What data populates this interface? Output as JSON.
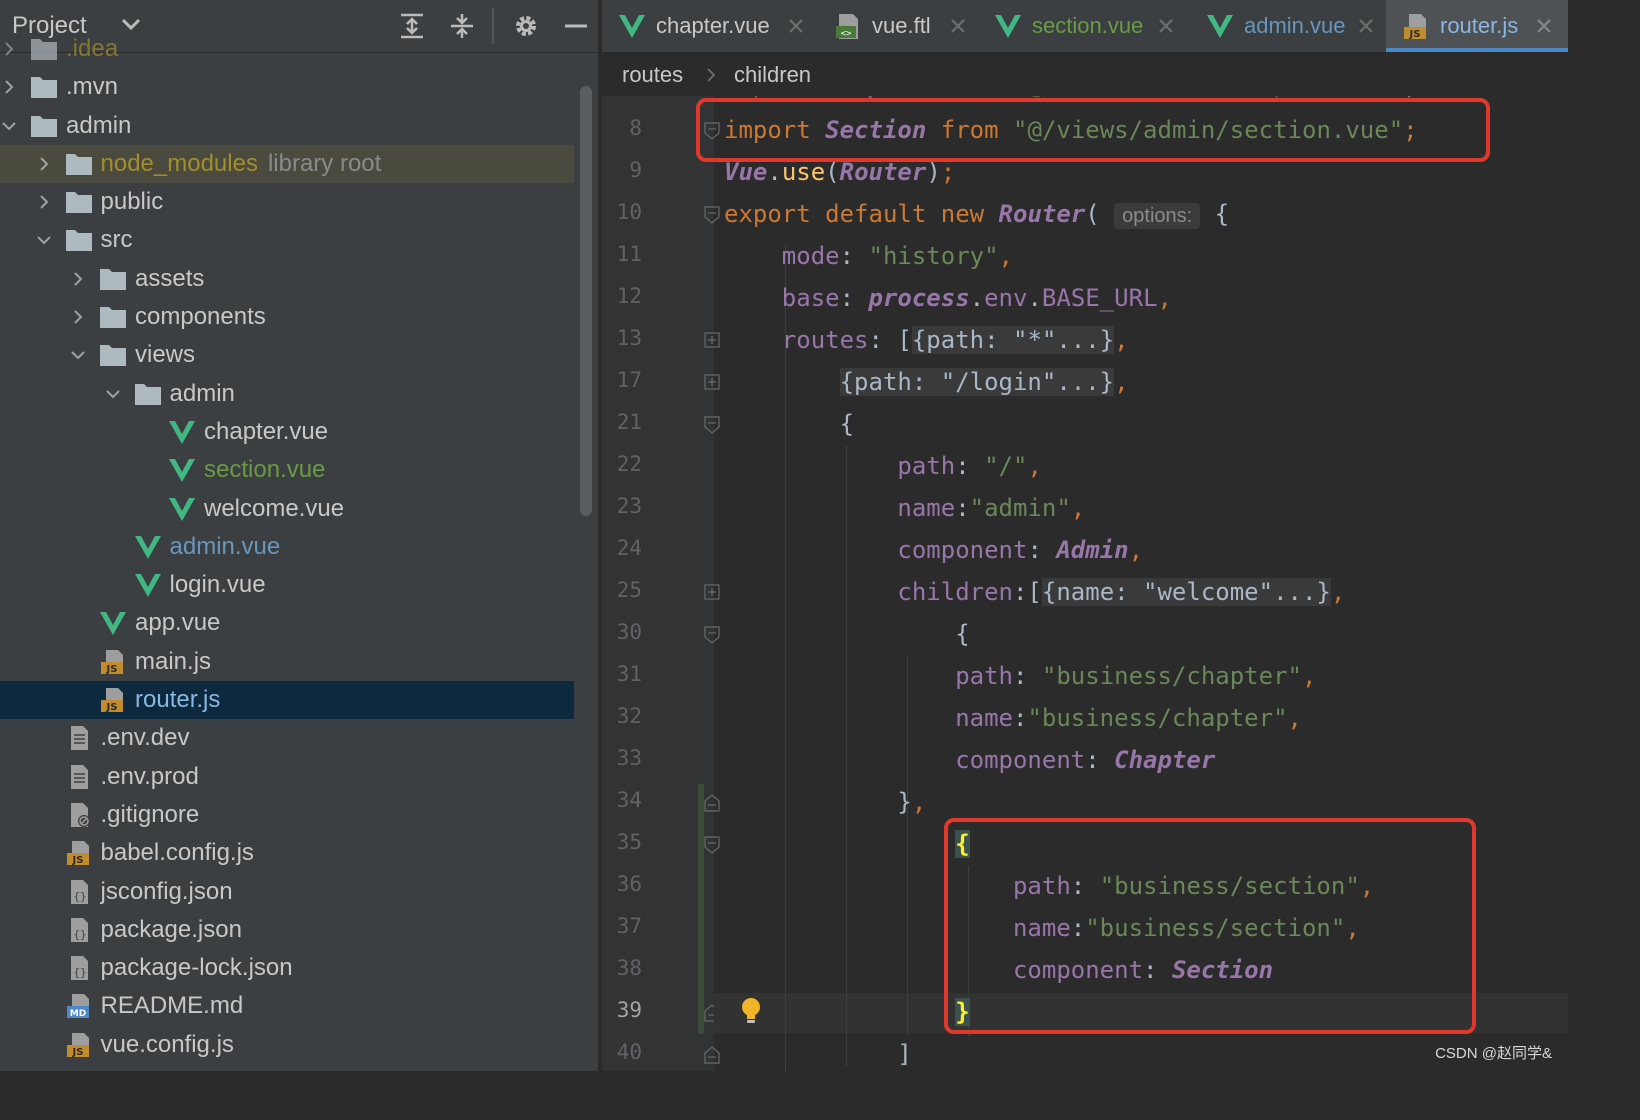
{
  "project_panel": {
    "title": "Project",
    "tree": [
      {
        "label": ".idea",
        "type": "folder",
        "depth": 0,
        "state": "collapsed",
        "style": "yellow"
      },
      {
        "label": ".mvn",
        "type": "folder",
        "depth": 0,
        "state": "collapsed"
      },
      {
        "label": "admin",
        "type": "folder",
        "depth": 0,
        "state": "expanded"
      },
      {
        "label": "node_modules",
        "suffix": "library root",
        "type": "folder",
        "depth": 1,
        "state": "collapsed",
        "style": "yellow",
        "highlight": true
      },
      {
        "label": "public",
        "type": "folder",
        "depth": 1,
        "state": "collapsed"
      },
      {
        "label": "src",
        "type": "folder",
        "depth": 1,
        "state": "expanded"
      },
      {
        "label": "assets",
        "type": "folder",
        "depth": 2,
        "state": "collapsed"
      },
      {
        "label": "components",
        "type": "folder",
        "depth": 2,
        "state": "collapsed"
      },
      {
        "label": "views",
        "type": "folder",
        "depth": 2,
        "state": "expanded"
      },
      {
        "label": "admin",
        "type": "folder",
        "depth": 3,
        "state": "expanded"
      },
      {
        "label": "chapter.vue",
        "type": "vue",
        "depth": 4
      },
      {
        "label": "section.vue",
        "type": "vue",
        "depth": 4,
        "style": "green"
      },
      {
        "label": "welcome.vue",
        "type": "vue",
        "depth": 4
      },
      {
        "label": "admin.vue",
        "type": "vue",
        "depth": 3,
        "style": "blue"
      },
      {
        "label": "login.vue",
        "type": "vue",
        "depth": 3
      },
      {
        "label": "app.vue",
        "type": "vue",
        "depth": 2
      },
      {
        "label": "main.js",
        "type": "js",
        "depth": 2
      },
      {
        "label": "router.js",
        "type": "js",
        "depth": 2,
        "selected": true
      },
      {
        "label": ".env.dev",
        "type": "text",
        "depth": 1
      },
      {
        "label": ".env.prod",
        "type": "text",
        "depth": 1
      },
      {
        "label": ".gitignore",
        "type": "ignore",
        "depth": 1
      },
      {
        "label": "babel.config.js",
        "type": "js",
        "depth": 1
      },
      {
        "label": "jsconfig.json",
        "type": "json",
        "depth": 1
      },
      {
        "label": "package.json",
        "type": "json",
        "depth": 1
      },
      {
        "label": "package-lock.json",
        "type": "json",
        "depth": 1
      },
      {
        "label": "README.md",
        "type": "md",
        "depth": 1
      },
      {
        "label": "vue.config.js",
        "type": "js",
        "depth": 1
      }
    ]
  },
  "tabs": [
    {
      "label": "chapter.vue",
      "icon": "vue-icon"
    },
    {
      "label": "vue.ftl",
      "icon": "ftl-icon"
    },
    {
      "label": "section.vue",
      "icon": "vue-icon",
      "style": "green"
    },
    {
      "label": "admin.vue",
      "icon": "vue-icon",
      "style": "blue"
    },
    {
      "label": "router.js",
      "icon": "js-icon",
      "active": true,
      "style": "blue"
    }
  ],
  "breadcrumb": [
    "routes",
    "children"
  ],
  "editor": {
    "current_line": 39,
    "hint_label": "options:",
    "lines": [
      {
        "n": 8,
        "fold": "start"
      },
      {
        "n": 9
      },
      {
        "n": 10,
        "fold": "start"
      },
      {
        "n": 11
      },
      {
        "n": 12
      },
      {
        "n": 13,
        "fold": "collapsed"
      },
      {
        "n": 17,
        "fold": "collapsed"
      },
      {
        "n": 21,
        "fold": "start"
      },
      {
        "n": 22
      },
      {
        "n": 23
      },
      {
        "n": 24
      },
      {
        "n": 25,
        "fold": "collapsed"
      },
      {
        "n": 30,
        "fold": "start"
      },
      {
        "n": 31
      },
      {
        "n": 32
      },
      {
        "n": 33
      },
      {
        "n": 34,
        "fold": "end"
      },
      {
        "n": 35,
        "fold": "start"
      },
      {
        "n": 36
      },
      {
        "n": 37
      },
      {
        "n": 38
      },
      {
        "n": 39,
        "fold": "end"
      },
      {
        "n": 40,
        "fold": "end"
      }
    ]
  },
  "watermark": "CSDN @赵同学&",
  "colors": {
    "keyword": "#cc7832",
    "string": "#6a8759",
    "property": "#9876aa",
    "function": "#ffc66d",
    "annotation_box": "#e0392b",
    "vue_green": "#41b883"
  }
}
